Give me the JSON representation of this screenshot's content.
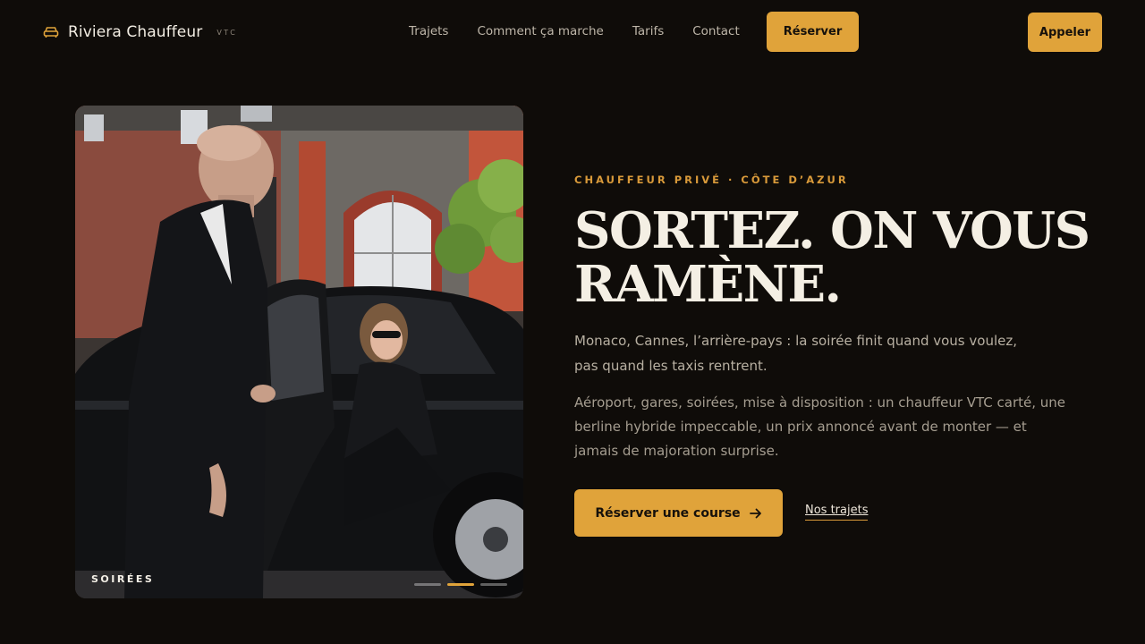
{
  "brand": {
    "name": "Riviera Chauffeur",
    "tag": "VTC",
    "icon": "car-icon"
  },
  "nav": {
    "items": [
      "Trajets",
      "Comment ça marche",
      "Tarifs",
      "Contact"
    ],
    "reserve_label": "Réserver",
    "call_label": "Appeler"
  },
  "colors": {
    "background": "#0f0c09",
    "accent": "#e0a33a"
  },
  "hero": {
    "photo_label": "SOIRÉES",
    "slides_total": 3,
    "slide_active": 2,
    "eyebrow": "CHAUFFEUR PRIVÉ · CÔTE D’AZUR",
    "title_line1": "SORTEZ. ON VOUS",
    "title_line2": "RAMÈNE.",
    "lead": "Monaco, Cannes, l’arrière-pays : la soirée finit quand vous voulez, pas quand les taxis rentrent.",
    "body": "Aéroport, gares, soirées, mise à disposition : un chauffeur VTC carté, une berline hybride impeccable, un prix annoncé avant de monter — et jamais de majoration surprise.",
    "cta_label": "Réserver une course",
    "cta_icon": "arrow-right-icon",
    "secondary_link": "Nos trajets"
  }
}
